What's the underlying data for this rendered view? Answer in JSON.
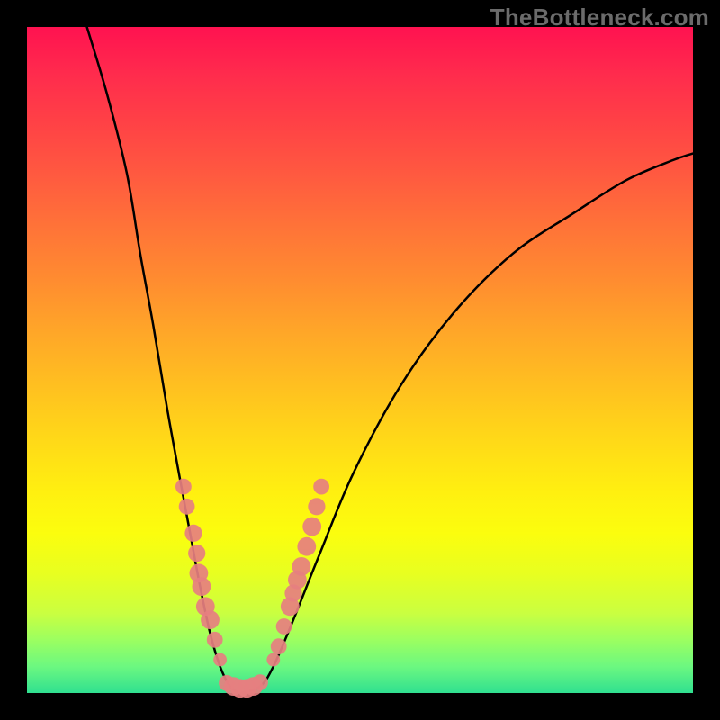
{
  "watermark": "TheBottleneck.com",
  "chart_data": {
    "type": "line",
    "title": "",
    "xlabel": "",
    "ylabel": "",
    "xlim": [
      0,
      100
    ],
    "ylim": [
      0,
      100
    ],
    "grid": false,
    "legend": false,
    "curve_left": {
      "name": "left-branch",
      "points": [
        {
          "x": 9,
          "y": 100
        },
        {
          "x": 12,
          "y": 90
        },
        {
          "x": 15,
          "y": 78
        },
        {
          "x": 17,
          "y": 66
        },
        {
          "x": 19,
          "y": 55
        },
        {
          "x": 21,
          "y": 43
        },
        {
          "x": 23,
          "y": 32
        },
        {
          "x": 24.5,
          "y": 24
        },
        {
          "x": 26,
          "y": 16
        },
        {
          "x": 27.5,
          "y": 9
        },
        {
          "x": 29,
          "y": 4
        },
        {
          "x": 30.5,
          "y": 1
        },
        {
          "x": 32,
          "y": 0
        }
      ]
    },
    "curve_right": {
      "name": "right-branch",
      "points": [
        {
          "x": 32,
          "y": 0
        },
        {
          "x": 35,
          "y": 1
        },
        {
          "x": 37,
          "y": 4
        },
        {
          "x": 40,
          "y": 11
        },
        {
          "x": 44,
          "y": 21
        },
        {
          "x": 49,
          "y": 33
        },
        {
          "x": 56,
          "y": 46
        },
        {
          "x": 64,
          "y": 57
        },
        {
          "x": 73,
          "y": 66
        },
        {
          "x": 82,
          "y": 72
        },
        {
          "x": 90,
          "y": 77
        },
        {
          "x": 97,
          "y": 80
        },
        {
          "x": 100,
          "y": 81
        }
      ]
    },
    "scatter_left": {
      "name": "left-cluster",
      "points": [
        {
          "x": 23.5,
          "y": 31,
          "r": 1.2
        },
        {
          "x": 24.0,
          "y": 28,
          "r": 1.2
        },
        {
          "x": 25.0,
          "y": 24,
          "r": 1.3
        },
        {
          "x": 25.5,
          "y": 21,
          "r": 1.3
        },
        {
          "x": 25.8,
          "y": 18,
          "r": 1.4
        },
        {
          "x": 26.2,
          "y": 16,
          "r": 1.4
        },
        {
          "x": 26.8,
          "y": 13,
          "r": 1.4
        },
        {
          "x": 27.5,
          "y": 11,
          "r": 1.4
        },
        {
          "x": 28.2,
          "y": 8,
          "r": 1.2
        },
        {
          "x": 29.0,
          "y": 5,
          "r": 1.0
        }
      ]
    },
    "scatter_right": {
      "name": "right-cluster",
      "points": [
        {
          "x": 37.0,
          "y": 5,
          "r": 1.0
        },
        {
          "x": 37.8,
          "y": 7,
          "r": 1.2
        },
        {
          "x": 38.6,
          "y": 10,
          "r": 1.2
        },
        {
          "x": 39.5,
          "y": 13,
          "r": 1.4
        },
        {
          "x": 40.0,
          "y": 15,
          "r": 1.3
        },
        {
          "x": 40.6,
          "y": 17,
          "r": 1.4
        },
        {
          "x": 41.2,
          "y": 19,
          "r": 1.4
        },
        {
          "x": 42.0,
          "y": 22,
          "r": 1.4
        },
        {
          "x": 42.8,
          "y": 25,
          "r": 1.4
        },
        {
          "x": 43.5,
          "y": 28,
          "r": 1.3
        },
        {
          "x": 44.2,
          "y": 31,
          "r": 1.2
        }
      ]
    },
    "scatter_bottom": {
      "name": "trough-cluster",
      "points": [
        {
          "x": 30.0,
          "y": 1.5,
          "r": 1.2
        },
        {
          "x": 31.0,
          "y": 1.0,
          "r": 1.4
        },
        {
          "x": 32.0,
          "y": 0.7,
          "r": 1.4
        },
        {
          "x": 33.0,
          "y": 0.7,
          "r": 1.4
        },
        {
          "x": 34.0,
          "y": 1.0,
          "r": 1.4
        },
        {
          "x": 35.0,
          "y": 1.6,
          "r": 1.2
        }
      ]
    }
  }
}
